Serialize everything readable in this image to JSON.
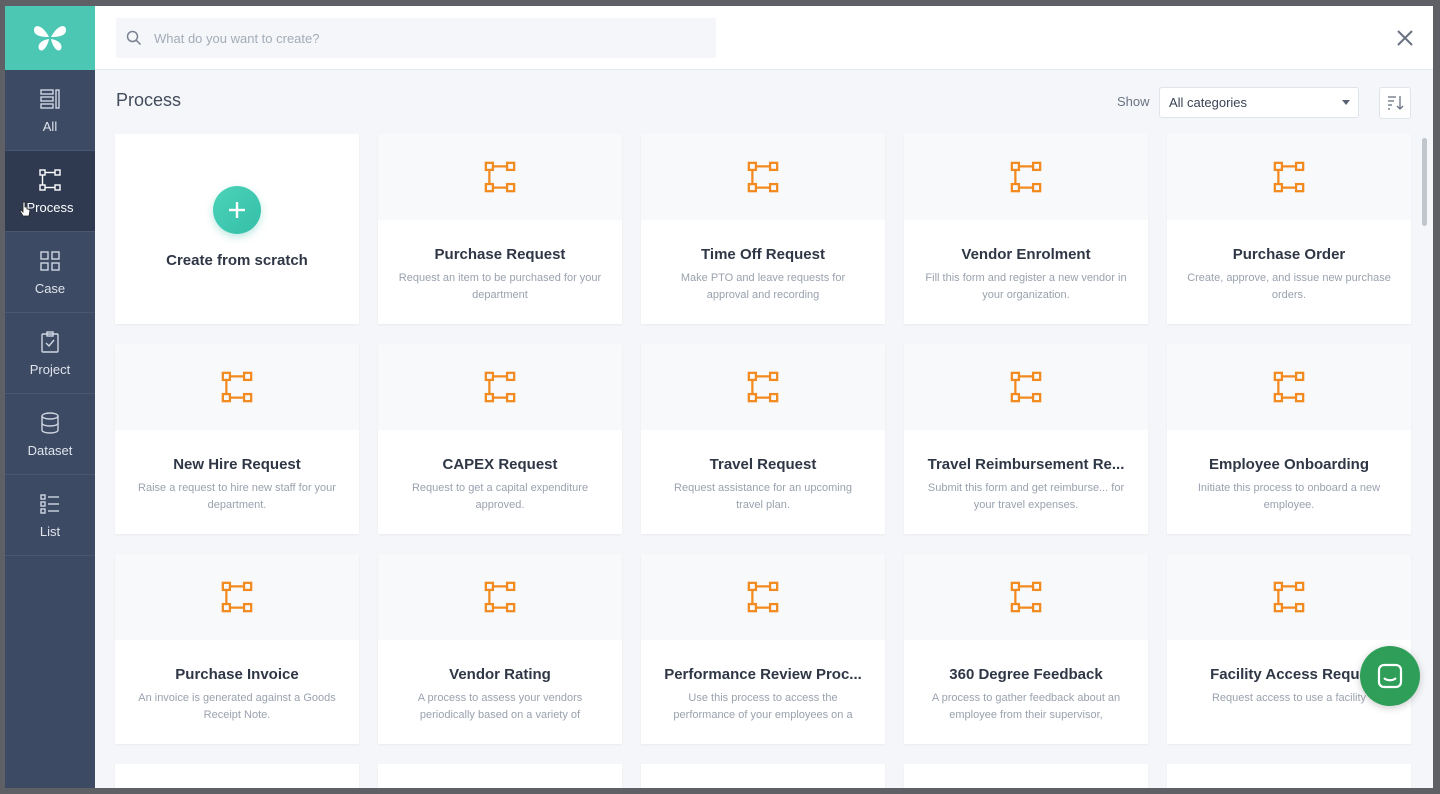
{
  "sidebar": {
    "items": [
      {
        "label": "All",
        "icon": "all-icon"
      },
      {
        "label": "Process",
        "icon": "process-icon"
      },
      {
        "label": "Case",
        "icon": "case-icon"
      },
      {
        "label": "Project",
        "icon": "project-icon"
      },
      {
        "label": "Dataset",
        "icon": "dataset-icon"
      },
      {
        "label": "List",
        "icon": "list-icon"
      }
    ],
    "active": "Process"
  },
  "search": {
    "placeholder": "What do you want to create?",
    "value": ""
  },
  "header": {
    "title": "Process",
    "show_label": "Show",
    "category_selected": "All categories"
  },
  "scratch_card": {
    "label": "Create from scratch"
  },
  "cards": [
    {
      "title": "Purchase Request",
      "desc": "Request an item to be purchased for your department"
    },
    {
      "title": "Time Off Request",
      "desc": "Make PTO and leave requests for approval and recording"
    },
    {
      "title": "Vendor Enrolment",
      "desc": "Fill this form and register a new vendor in your organization."
    },
    {
      "title": "Purchase Order",
      "desc": "Create, approve, and issue new purchase orders."
    },
    {
      "title": "New Hire Request",
      "desc": "Raise a request to hire new staff for your department."
    },
    {
      "title": "CAPEX Request",
      "desc": "Request to get a capital expenditure approved."
    },
    {
      "title": "Travel Request",
      "desc": "Request assistance for an upcoming travel plan."
    },
    {
      "title": "Travel Reimbursement Re...",
      "desc": "Submit this form and get reimburse... for your travel expenses."
    },
    {
      "title": "Employee Onboarding",
      "desc": "Initiate this process to onboard a new employee."
    },
    {
      "title": "Purchase Invoice",
      "desc": "An invoice is generated against a Goods Receipt Note."
    },
    {
      "title": "Vendor Rating",
      "desc": "A process to assess your vendors periodically based on a variety of"
    },
    {
      "title": "Performance Review Proc...",
      "desc": "Use this process to access the performance of your employees on a"
    },
    {
      "title": "360 Degree Feedback",
      "desc": "A process to gather feedback about an employee from their supervisor,"
    },
    {
      "title": "Facility Access Reque",
      "desc": "Request access to use a facility"
    }
  ],
  "colors": {
    "sidebar": "#3d4a63",
    "sidebar_active": "#2f3a50",
    "logo_bg": "#4cc7b4",
    "accent_orange": "#f28a1f",
    "plus_green": "#3cc7ad",
    "chat_green": "#2e9e59"
  }
}
